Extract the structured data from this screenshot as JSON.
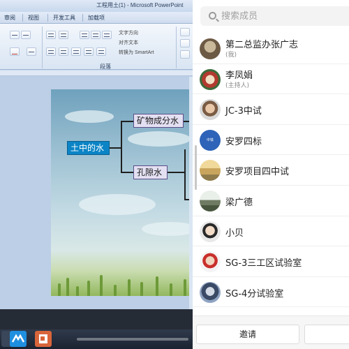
{
  "ppt": {
    "window_title": "工程用土(1) - Microsoft PowerPoint",
    "tabs": [
      "审阅",
      "视图",
      "开发工具",
      "加载项"
    ],
    "ribbon": {
      "text_direction": "文字方向",
      "align_text": "对齐文本",
      "convert_smartart": "转换为 SmartArt",
      "group_paragraph": "段落"
    },
    "mindmap": {
      "root": "土中的水",
      "children": [
        "矿物成分水",
        "孔隙水"
      ]
    }
  },
  "panel": {
    "search": {
      "placeholder": "搜索成员"
    },
    "members": [
      {
        "name": "第二总监办张广志",
        "note": "(我)",
        "avatar": "avatar-icon"
      },
      {
        "name": "李凤娟",
        "note": "(主持人)",
        "avatar": "avatar-icon"
      },
      {
        "name": "JC-3中试",
        "note": "",
        "avatar": "avatar-icon"
      },
      {
        "name": "安罗四标",
        "note": "",
        "avatar": "avatar-icon",
        "avatar_text": "中铁"
      },
      {
        "name": "安罗项目四中试",
        "note": "",
        "avatar": "avatar-icon"
      },
      {
        "name": "梁广德",
        "note": "",
        "avatar": "avatar-icon"
      },
      {
        "name": "小贝",
        "note": "",
        "avatar": "avatar-icon"
      },
      {
        "name": "SG-3三工区试验室",
        "note": "",
        "avatar": "avatar-icon"
      },
      {
        "name": "SG-4分试验室",
        "note": "",
        "avatar": "avatar-icon"
      }
    ],
    "footer": {
      "invite": "邀请"
    }
  },
  "colors": {
    "mindmap_root": "#0b84c6",
    "mindmap_child": "#e4e0f3",
    "avatar_blue": "#2d63b8"
  }
}
